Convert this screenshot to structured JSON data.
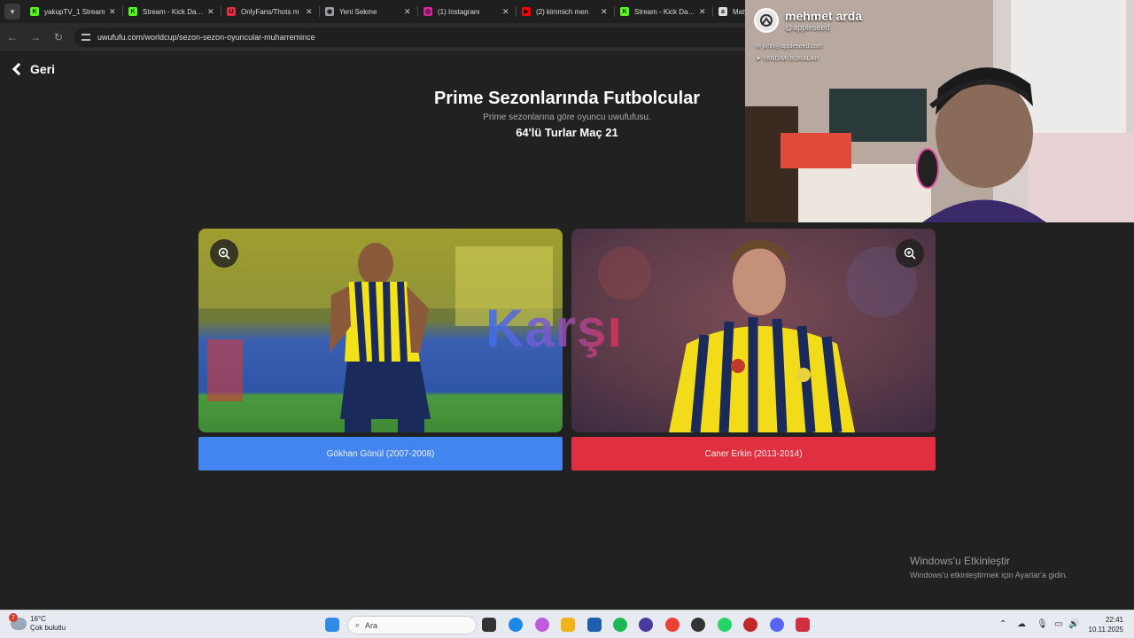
{
  "tabs": [
    {
      "title": "yakupTV_1 Stream",
      "favicon_color": "#53fc18",
      "favicon_glyph": "K"
    },
    {
      "title": "Stream - Kick Dashboard",
      "favicon_color": "#53fc18",
      "favicon_glyph": "K"
    },
    {
      "title": "OnlyFans/Thots m",
      "favicon_color": "#e0303f",
      "favicon_glyph": "U"
    },
    {
      "title": "Yeni Sekme",
      "favicon_color": "#9aa0a6",
      "favicon_glyph": "◉"
    },
    {
      "title": "(1) Instagram",
      "favicon_color": "#d6249f",
      "favicon_glyph": "◎"
    },
    {
      "title": "(2) kimmich men",
      "favicon_color": "#ff0000",
      "favicon_glyph": "▶"
    },
    {
      "title": "Stream - Kick Dashboard",
      "favicon_color": "#53fc18",
      "favicon_glyph": "K"
    },
    {
      "title": "Maty",
      "favicon_color": "#dddddd",
      "favicon_glyph": "a"
    }
  ],
  "address_bar": {
    "url": "uwufufu.com/worldcup/sezon-sezon-oyuncular-muharremince"
  },
  "page": {
    "back_label": "Geri",
    "title": "Prime Sezonlarında Futbolcular",
    "subtitle": "Prime sezonlarına göre oyuncu uwufufusu.",
    "round": "64'lü Turlar Maç 21",
    "vs_label": "Karşı",
    "left_choice": {
      "label": "Gökhan Gönül (2007-2008)",
      "color": "#4285f0"
    },
    "right_choice": {
      "label": "Caner Erkin (2013-2014)",
      "color": "#e0303f"
    }
  },
  "webcam": {
    "name": "mehmet arda",
    "handle": "@appleseed",
    "email": "john@appleseed.com",
    "location": "YANDIMI BURALAR"
  },
  "watermark": {
    "line1": "Windows'u Etkinleştir",
    "line2": "Windows'u etkinleştirmek için Ayarlar'a gidin."
  },
  "taskbar": {
    "weather_temp": "16°C",
    "weather_desc": "Çok bulutlu",
    "weather_badge": "7",
    "search_placeholder": "Ara",
    "time": "22:41",
    "date": "10.11.2025"
  }
}
